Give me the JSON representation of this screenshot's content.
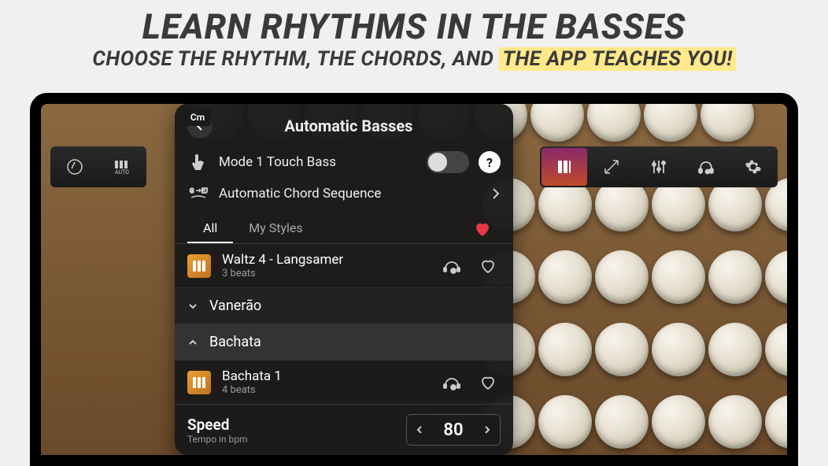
{
  "promo": {
    "title": "LEARN RHYTHMS IN THE BASSES",
    "subtitle_pre": "CHOOSE THE RHYTHM, THE CHORDS, AND ",
    "subtitle_highlight": "THE APP TEACHES YOU!"
  },
  "chord_badge": "Cm",
  "panel": {
    "title": "Automatic Basses",
    "mode_touch": "Mode 1 Touch Bass",
    "auto_chord": "Automatic Chord Sequence",
    "tabs": {
      "all": "All",
      "my": "My Styles"
    },
    "styles": [
      {
        "name": "Waltz 4 - Langsamer",
        "beats": "3 beats"
      }
    ],
    "groups": [
      {
        "name": "Vanerão",
        "expanded": false
      },
      {
        "name": "Bachata",
        "expanded": true,
        "items": [
          {
            "name": "Bachata 1",
            "beats": "4 beats"
          }
        ]
      }
    ],
    "speed": {
      "label": "Speed",
      "sub": "Tempo in bpm",
      "value": "80"
    }
  },
  "toolbar": {
    "left": [
      "tuning",
      "auto"
    ],
    "right": [
      "style",
      "size",
      "mixer",
      "headphones",
      "settings"
    ]
  }
}
